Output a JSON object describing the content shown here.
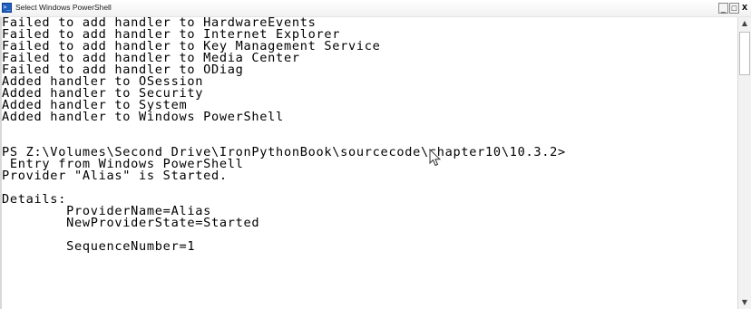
{
  "window": {
    "title": "Select Windows PowerShell",
    "icon": "powershell-icon",
    "app_icon_glyph": ">_",
    "controls": {
      "minimize": "_",
      "maximize": "□",
      "close": "x"
    }
  },
  "console": {
    "lines": [
      "Failed to add handler to HardwareEvents",
      "Failed to add handler to Internet Explorer",
      "Failed to add handler to Key Management Service",
      "Failed to add handler to Media Center",
      "Failed to add handler to ODiag",
      "Added handler to OSession",
      "Added handler to Security",
      "Added handler to System",
      "Added handler to Windows PowerShell",
      "",
      "",
      "PS Z:\\Volumes\\Second Drive\\IronPythonBook\\sourcecode\\chapter10\\10.3.2>",
      " Entry from Windows PowerShell",
      "Provider \"Alias\" is Started.",
      "",
      "Details:",
      "        ProviderName=Alias",
      "        NewProviderState=Started",
      "",
      "        SequenceNumber=1"
    ]
  },
  "scrollbar": {
    "up_glyph": "▲",
    "down_glyph": "▼"
  },
  "colors": {
    "console_background": "#ffffff",
    "console_text": "#000000",
    "titlebar": "#f4f4f4"
  }
}
